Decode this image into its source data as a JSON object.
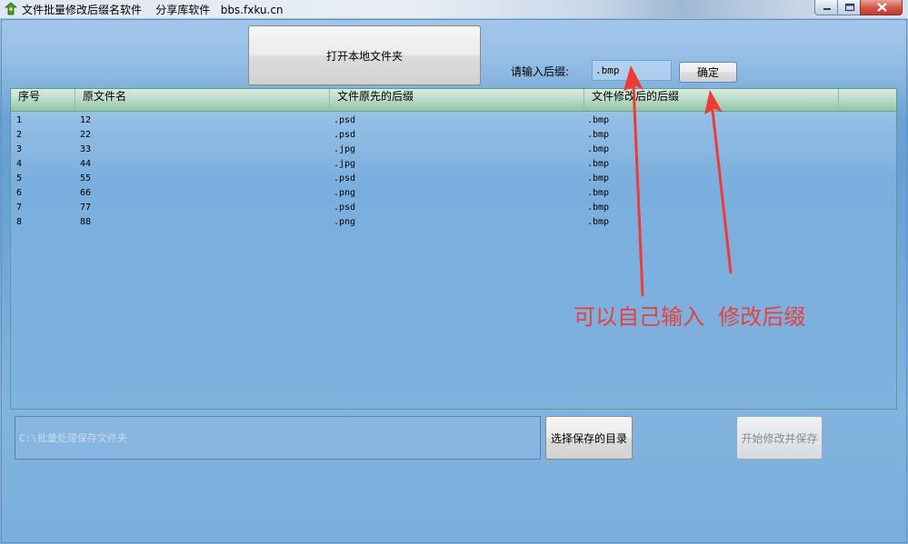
{
  "window": {
    "title": "文件批量修改后缀名软件    分享库软件   bbs.fxku.cn",
    "icon": "app-icon",
    "controls": [
      "minimize-icon",
      "maximize-icon",
      "close-icon"
    ]
  },
  "toolbar": {
    "open_folder_label": "打开本地文件夹",
    "suffix_label": "请输入后缀:",
    "suffix_value": ".bmp",
    "confirm_label": "确定"
  },
  "table": {
    "columns": [
      "序号",
      "原文件名",
      "文件原先的后缀",
      "文件修改后的后缀"
    ],
    "rows": [
      [
        "1",
        "12",
        ".psd",
        ".bmp"
      ],
      [
        "2",
        "22",
        ".psd",
        ".bmp"
      ],
      [
        "3",
        "33",
        ".jpg",
        ".bmp"
      ],
      [
        "4",
        "44",
        ".jpg",
        ".bmp"
      ],
      [
        "5",
        "55",
        ".psd",
        ".bmp"
      ],
      [
        "6",
        "66",
        ".png",
        ".bmp"
      ],
      [
        "7",
        "77",
        ".psd",
        ".bmp"
      ],
      [
        "8",
        "88",
        ".png",
        ".bmp"
      ]
    ]
  },
  "footer": {
    "save_path_value": "C:\\批量处理保存文件夹",
    "choose_dir_label": "选择保存的目录",
    "start_save_label": "开始修改并保存"
  },
  "annotation": {
    "text": "可以自己输入  修改后缀",
    "color": "#e8403a"
  }
}
